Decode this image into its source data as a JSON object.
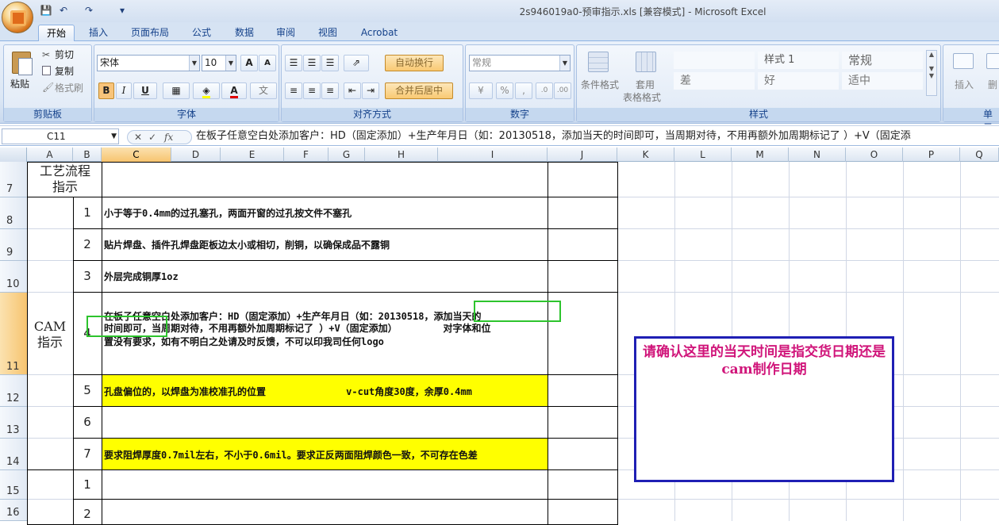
{
  "window": {
    "title": "2s946019a0-预审指示.xls  [兼容模式] - Microsoft Excel"
  },
  "qat": {
    "save_icon": "save-icon",
    "undo_icon": "undo-icon",
    "redo_icon": "redo-icon"
  },
  "tabs": [
    {
      "label": "开始",
      "active": true
    },
    {
      "label": "插入"
    },
    {
      "label": "页面布局"
    },
    {
      "label": "公式"
    },
    {
      "label": "数据"
    },
    {
      "label": "审阅"
    },
    {
      "label": "视图"
    },
    {
      "label": "Acrobat"
    }
  ],
  "ribbon": {
    "clipboard": {
      "label": "剪贴板",
      "paste": "粘贴",
      "cut": "剪切",
      "copy": "复制",
      "format_painter": "格式刷"
    },
    "font": {
      "label": "字体",
      "font_name": "宋体",
      "font_size": "10",
      "bold": "B",
      "italic": "I",
      "underline": "U",
      "grow": "A",
      "shrink": "A"
    },
    "alignment": {
      "label": "对齐方式",
      "wrap": "自动换行",
      "merge": "合并后居中"
    },
    "number": {
      "label": "数字",
      "format": "常规",
      "percent": "%",
      "comma": ","
    },
    "styles": {
      "label": "样式",
      "conditional": "条件格式",
      "table_format": "套用",
      "table_format2": "表格格式",
      "cells": [
        "",
        "样式 1",
        "常规",
        "差",
        "好",
        "适中"
      ]
    },
    "cells": {
      "label": "单元",
      "insert": "插入",
      "delete": "删"
    }
  },
  "formula_bar": {
    "name_box": "C11",
    "fx": "fx",
    "content": "在板子任意空白处添加客户：HD（固定添加）+生产年月日（如：20130518，添加当天的时间即可，当周期对待，不用再额外加周期标记了 ）+V（固定添"
  },
  "columns": [
    "A",
    "B",
    "C",
    "D",
    "E",
    "F",
    "G",
    "H",
    "I",
    "J",
    "K",
    "L",
    "M",
    "N",
    "O",
    "P",
    "Q"
  ],
  "rows": [
    "7",
    "8",
    "9",
    "10",
    "11",
    "12",
    "13",
    "14",
    "15",
    "16"
  ],
  "sheet": {
    "a7": "工艺流程\n指示",
    "a_cam": "CAM\n指示",
    "b": [
      "1",
      "2",
      "3",
      "4",
      "5",
      "6",
      "7",
      "1",
      "2"
    ],
    "c8": "小于等于0.4mm的过孔塞孔，两面开窗的过孔按文件不塞孔",
    "c9": "贴片焊盘、插件孔焊盘距板边太小或相切，削铜，以确保成品不露铜",
    "c10": "外层完成铜厚1oz",
    "c11_line1": "在板子任意空白处添加客户：HD（固定添加）+生产年月日（如：20130518，添加当天的",
    "c11_line2": "时间即可，当周期对待，不用再额外加周期标记了 ）+V（固定添加）        对字体和位",
    "c11_line3": "置没有要求，如有不明白之处请及时反馈，不可以印我司任何logo",
    "c12": "孔盘偏位的，以焊盘为准校准孔的位置              v-cut角度30度，余厚0.4mm",
    "c14": "要求阻焊厚度0.7mil左右，不小于0.6mil。要求正反两面阻焊颜色一致，不可存在色差",
    "note": "请确认这里的当天时间是指交货日期还是cam制作日期"
  },
  "colors": {
    "highlight": "#ffff00",
    "note_border": "#1f1fb4",
    "note_text": "#d0157a",
    "annot_border": "#2dc42d"
  }
}
